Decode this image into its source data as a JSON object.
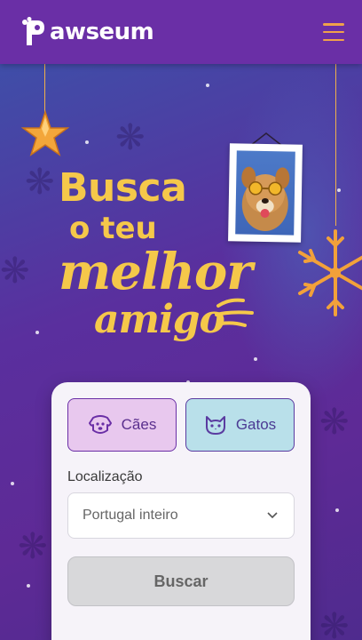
{
  "header": {
    "logo_text": "awseum",
    "logo_initial": "P",
    "menu_icon": "hamburger-icon"
  },
  "hero": {
    "headline": {
      "line1": "Busca",
      "line2": "o teu",
      "line3": "melhor",
      "line4": "amigo"
    }
  },
  "search": {
    "tabs": [
      {
        "label": "Cães",
        "icon": "dog-icon"
      },
      {
        "label": "Gatos",
        "icon": "cat-icon"
      }
    ],
    "location_label": "Localização",
    "location_value": "Portugal inteiro",
    "submit_label": "Buscar"
  },
  "colors": {
    "header_bg": "#6a2fa6",
    "accent_yellow": "#f5c84a",
    "menu_orange": "#f0a24a",
    "dogs_tab_bg": "#e8c8ee",
    "cats_tab_bg": "#b9e0ea"
  }
}
